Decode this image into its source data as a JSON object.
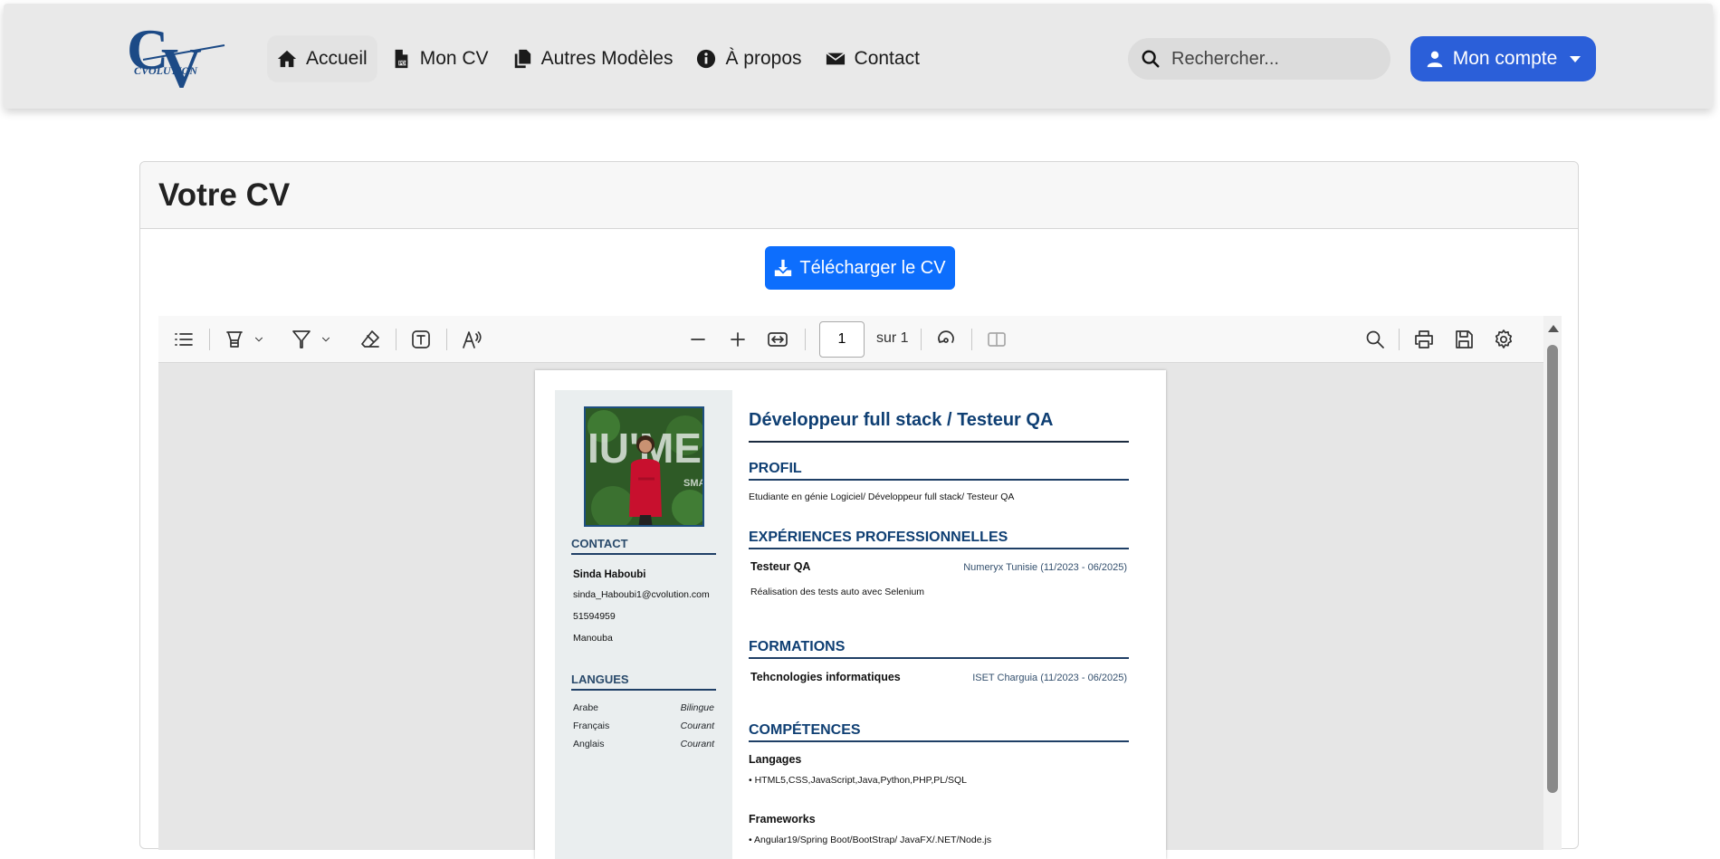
{
  "navbar": {
    "links": [
      {
        "label": "Accueil",
        "icon": "home-icon"
      },
      {
        "label": "Mon CV",
        "icon": "pdf-file-icon"
      },
      {
        "label": "Autres Modèles",
        "icon": "copy-icon"
      },
      {
        "label": "À propos",
        "icon": "info-icon"
      },
      {
        "label": "Contact",
        "icon": "envelope-icon"
      }
    ],
    "search_placeholder": "Rechercher...",
    "account_label": "Mon compte",
    "logo_text": "CVOLUTION"
  },
  "card": {
    "title": "Votre CV",
    "download_label": "Télécharger le CV"
  },
  "viewer": {
    "page_current": "1",
    "page_total": "sur 1"
  },
  "cv": {
    "headline": "Développeur full stack / Testeur QA",
    "contact_title": "CONTACT",
    "name": "Sinda Haboubi",
    "email": "sinda_Haboubi1@cvolution.com",
    "phone": "51594959",
    "city": "Manouba",
    "languages_title": "LANGUES",
    "languages": [
      {
        "name": "Arabe",
        "level": "Bilingue"
      },
      {
        "name": "Français",
        "level": "Courant"
      },
      {
        "name": "Anglais",
        "level": "Courant"
      }
    ],
    "profile_title": "PROFIL",
    "profile_text": "Etudiante en génie Logiciel/ Développeur full stack/ Testeur QA",
    "experience_title": "EXPÉRIENCES PROFESSIONNELLES",
    "experience": {
      "role": "Testeur QA",
      "meta": "Numeryx Tunisie (11/2023 - 06/2025)",
      "desc": "Réalisation des tests auto avec Selenium"
    },
    "education_title": "FORMATIONS",
    "education": {
      "degree": "Tehcnologies informatiques",
      "meta": "ISET Charguia (11/2023 - 06/2025)"
    },
    "skills_title": "COMPÉTENCES",
    "skills": [
      {
        "head": "Langages",
        "items": "• HTML5,CSS,JavaScript,Java,Python,PHP,PL/SQL"
      },
      {
        "head": "Frameworks",
        "items": "• Angular19/Spring Boot/BootStrap/ JavaFX/.NET/Node.js"
      }
    ]
  },
  "colors": {
    "accent_blue": "#2b5fd9",
    "download_blue": "#0d6efd",
    "cv_heading": "#0f3f73"
  }
}
